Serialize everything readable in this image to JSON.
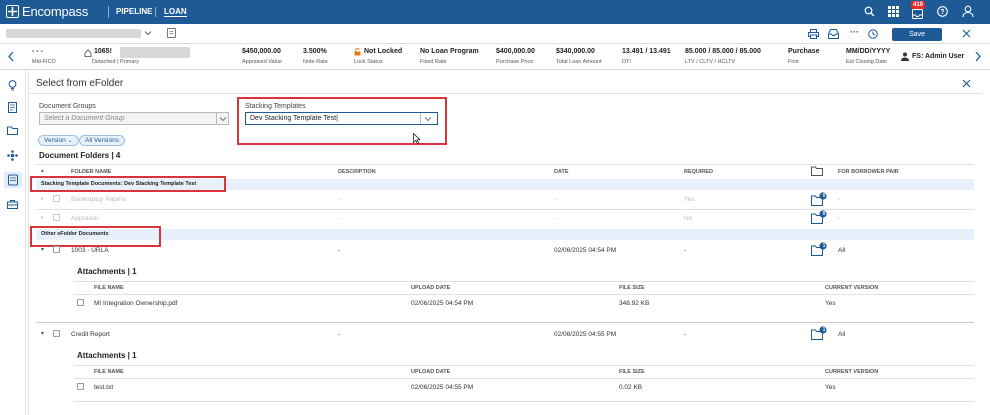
{
  "app": {
    "brand": "Encompass",
    "nav": [
      "PIPELINE",
      "LOAN"
    ],
    "notification_count": "419"
  },
  "loanbar": {
    "save_label": "Save",
    "user_label": "FS: Admin User"
  },
  "info": [
    {
      "value": "- - -",
      "key": "Mid-FICO"
    },
    {
      "value": "1065!",
      "key": "Detached | Primary"
    },
    {
      "value": "$450,000.00",
      "key": "Appraised Value"
    },
    {
      "value": "3.500%",
      "key": "Note Rate"
    },
    {
      "value": "Not Locked",
      "key": "Lock Status"
    },
    {
      "value": "No Loan Program",
      "key": "Fixed Rate"
    },
    {
      "value": "$400,000.00",
      "key": "Purchase Price"
    },
    {
      "value": "$340,000.00",
      "key": "Total Loan Amount"
    },
    {
      "value": "13.491 / 13.491",
      "key": "DTI"
    },
    {
      "value": "85.000 / 85.000 / 85.000",
      "key": "LTV / CLTV / HCLTV"
    },
    {
      "value": "Purchase",
      "key": "First"
    },
    {
      "value": "MM/DD/YYYY",
      "key": "Est Closing Date"
    }
  ],
  "dialog": {
    "title": "Select from eFolder",
    "doc_groups_label": "Document Groups",
    "doc_groups_placeholder": "Select a Document Group",
    "stacking_label": "Stacking Templates",
    "stacking_value": "Dev Stacking Template Test|",
    "version_pill": "Version",
    "all_versions_pill": "All Versions",
    "folders_title": "Document Folders | 4"
  },
  "columns": {
    "folder_name": "FOLDER NAME",
    "description": "DESCRIPTION",
    "date": "DATE",
    "required": "REQUIRED",
    "borrower_pair": "FOR BORROWER PAIR"
  },
  "groups": {
    "stacking": "Stacking Template Documents: Dev Stacking Template Test",
    "other": "Other eFolder Documents"
  },
  "stacking_rows": [
    {
      "name": "Bankruptcy Papers",
      "description": "-",
      "date": "-",
      "required": "Yes",
      "badge": "0",
      "borrower": "-"
    },
    {
      "name": "Appraisal",
      "description": "-",
      "date": "-",
      "required": "No",
      "badge": "0",
      "borrower": "-"
    }
  ],
  "other_rows": [
    {
      "name": "1003 - URLA",
      "description": "-",
      "date": "02/06/2025 04:54 PM",
      "required": "-",
      "badge": "1",
      "borrower": "All",
      "attachments": {
        "title": "Attachments | 1",
        "file": "MI Integration Ownership.pdf",
        "upload": "02/06/2025 04:54 PM",
        "size": "348.92 KB",
        "current": "Yes"
      }
    },
    {
      "name": "Credit Report",
      "description": "-",
      "date": "02/06/2025 04:55 PM",
      "required": "-",
      "badge": "1",
      "borrower": "All",
      "attachments": {
        "title": "Attachments | 1",
        "file": "test.txt",
        "upload": "02/06/2025 04:55 PM",
        "size": "0.02 KB",
        "current": "Yes"
      }
    }
  ],
  "att_columns": {
    "file_name": "FILE NAME",
    "upload_date": "UPLOAD DATE",
    "file_size": "FILE SIZE",
    "current_version": "CURRENT VERSION"
  },
  "colors": {
    "brand": "#1e5a96",
    "highlight_red": "#d9343b",
    "group_bg": "#e8f1fb"
  }
}
